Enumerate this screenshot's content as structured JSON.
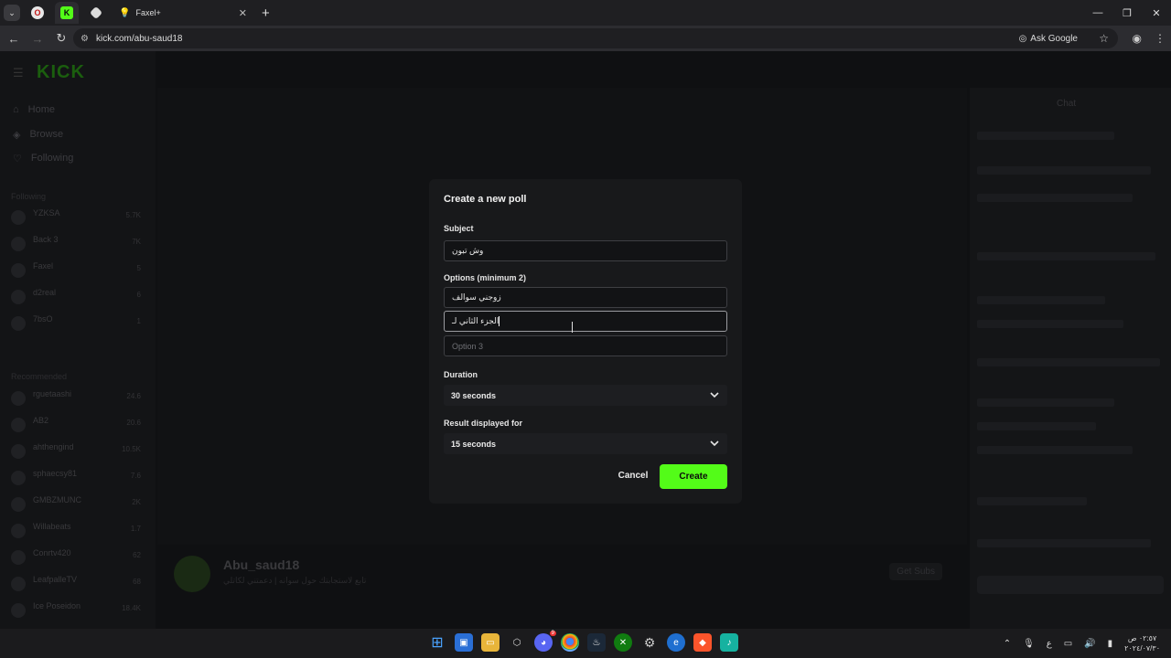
{
  "browser": {
    "tab_title": "Faxel+",
    "url": "kick.com/abu-saud18",
    "ask_google": "Ask Google",
    "colors": {
      "chrome_bg": "#1f1f22",
      "toolbar_bg": "#2c2c30"
    }
  },
  "page": {
    "logo": "KICK",
    "nav": [
      "Home",
      "Browse",
      "Following"
    ],
    "following_title": "Following",
    "following": [
      {
        "name": "YZKSA",
        "viewers": "5.7K"
      },
      {
        "name": "Back 3",
        "viewers": "7K"
      },
      {
        "name": "Faxel",
        "viewers": "5"
      },
      {
        "name": "d2real",
        "viewers": "6"
      },
      {
        "name": "7bsO",
        "viewers": "1"
      }
    ],
    "recommended_title": "Recommended",
    "recommended": [
      {
        "name": "rguetaashi",
        "viewers": "24.6"
      },
      {
        "name": "AB2",
        "viewers": "20.6"
      },
      {
        "name": "ahthengind",
        "viewers": "10.5K"
      },
      {
        "name": "sphaecsy81",
        "viewers": "7.6"
      },
      {
        "name": "GMBZMUNC",
        "viewers": "2K"
      },
      {
        "name": "Willabeats",
        "viewers": "1.7"
      },
      {
        "name": "Conrtv420",
        "viewers": "62"
      },
      {
        "name": "LeafpalleTV",
        "viewers": "68"
      },
      {
        "name": "Ice Poseidon",
        "viewers": "18.4K"
      }
    ],
    "streamer": {
      "name": "Abu_saud18",
      "title": "تابع لاستجابتك حول سوانه | دعمتني لكاتلي",
      "get_subs": "Get Subs"
    },
    "chat_title": "Chat"
  },
  "modal": {
    "title": "Create a new poll",
    "subject_label": "Subject",
    "subject_value": "وش تبون",
    "options_label": "Options (minimum 2)",
    "options": [
      {
        "value": "زوجني سوالف",
        "placeholder": ""
      },
      {
        "value": "الجزء الثاني لـ",
        "placeholder": ""
      },
      {
        "value": "",
        "placeholder": "Option 3"
      }
    ],
    "duration_label": "Duration",
    "duration_value": "30 seconds",
    "result_label": "Result displayed for",
    "result_value": "15 seconds",
    "cancel_label": "Cancel",
    "create_label": "Create",
    "colors": {
      "modal_bg": "#18191b",
      "accent": "#53fc18"
    }
  },
  "taskbar": {
    "lang": "ع",
    "time": "٠٢:٥٧ ص",
    "date": "٢٠٢٤/٠٧/٣٠",
    "icons": [
      "windows-icon",
      "store-icon",
      "files-icon",
      "unity-icon",
      "discord-icon",
      "chrome-icon",
      "steam-icon",
      "xbox-icon",
      "settings-icon",
      "edge-icon",
      "brave-icon",
      "audio-icon"
    ],
    "discord_badge": "9"
  }
}
